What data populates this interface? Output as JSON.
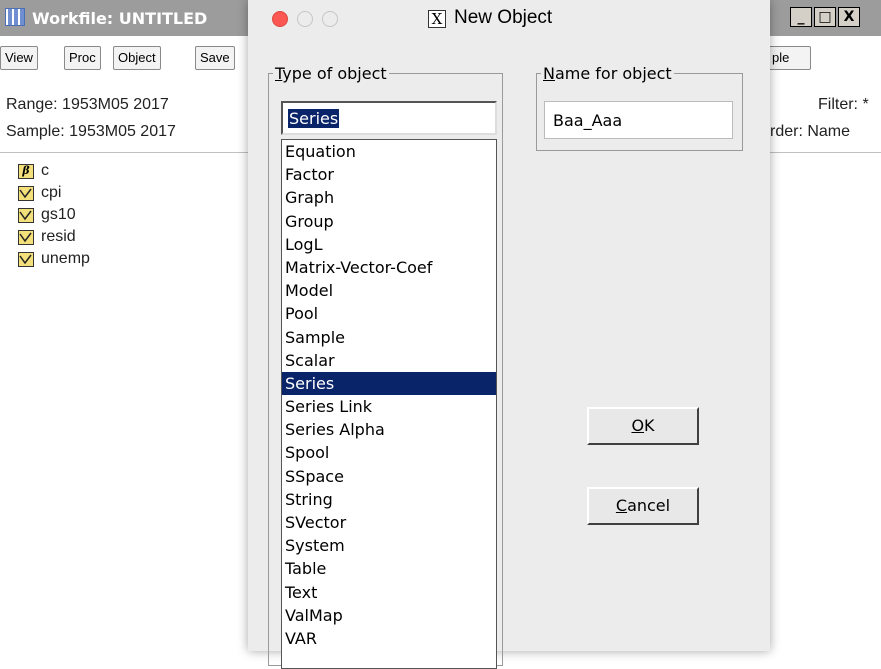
{
  "workfile": {
    "title": "Workfile: UNTITLED",
    "window_buttons": [
      "_",
      "□",
      "X"
    ],
    "toolbar_left": [
      "View",
      "Proc",
      "Object",
      "Save"
    ],
    "toolbar_right_fragment": "ple",
    "range_text": "Range:  1953M05 2017",
    "sample_text": "Sample: 1953M05 2017",
    "filter_text": "Filter: *",
    "order_text": "rder: Name",
    "objects": [
      {
        "icon": "coef-icon",
        "glyph": "β",
        "name": "c"
      },
      {
        "icon": "series-icon",
        "name": "cpi"
      },
      {
        "icon": "series-icon",
        "name": "gs10"
      },
      {
        "icon": "series-icon",
        "name": "resid"
      },
      {
        "icon": "series-icon",
        "name": "unemp"
      }
    ]
  },
  "dialog": {
    "title": "New Object",
    "x11_glyph": "X",
    "type_group": {
      "mnemonic": "T",
      "rest": "ype of object"
    },
    "name_group": {
      "mnemonic": "N",
      "rest": "ame for object"
    },
    "type_value": "Series",
    "name_value": "Baa_Aaa",
    "selected_type": "Series",
    "types": [
      "Equation",
      "Factor",
      "Graph",
      "Group",
      "LogL",
      "Matrix-Vector-Coef",
      "Model",
      "Pool",
      "Sample",
      "Scalar",
      "Series",
      "Series Link",
      "Series Alpha",
      "Spool",
      "SSpace",
      "String",
      "SVector",
      "System",
      "Table",
      "Text",
      "ValMap",
      "VAR"
    ],
    "ok": {
      "mnemonic": "O",
      "rest": "K"
    },
    "cancel": {
      "mnemonic": "C",
      "rest": "ancel"
    },
    "colors": {
      "selection": "#0a246a",
      "close_button": "#fc5753"
    }
  }
}
